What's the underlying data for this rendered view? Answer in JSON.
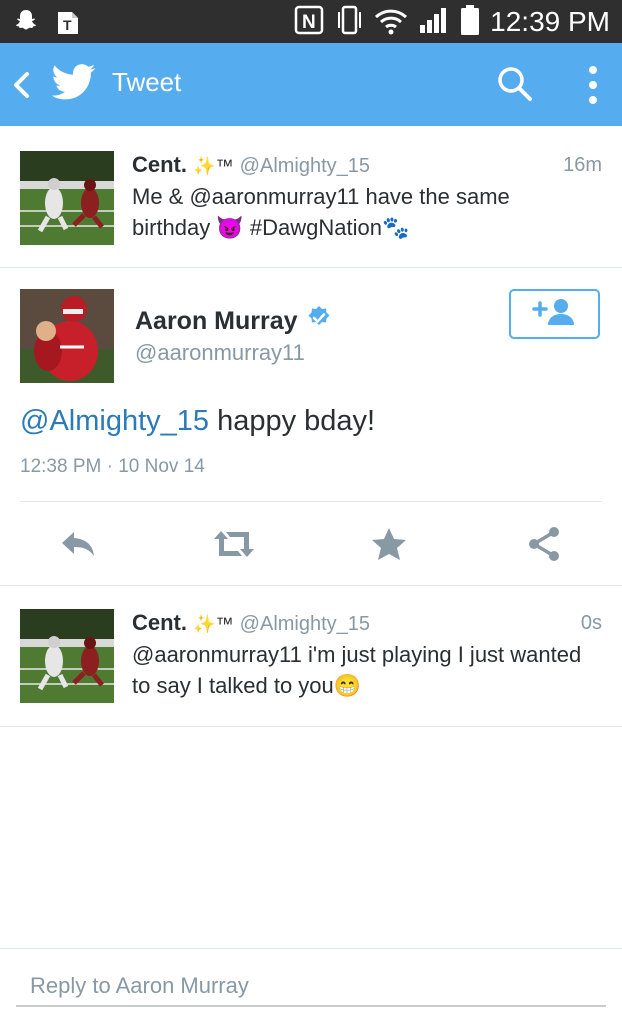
{
  "status_bar": {
    "time": "12:39 PM"
  },
  "action_bar": {
    "title": "Tweet"
  },
  "tweets_above": [
    {
      "name": "Cent.",
      "name_suffix": "✨™",
      "handle": "@Almighty_15",
      "time": "16m",
      "text": "Me & @aaronmurray11 have the same birthday 😈 #DawgNation🐾"
    }
  ],
  "main_tweet": {
    "name": "Aaron Murray",
    "handle": "@aaronmurray11",
    "mention": "@Almighty_15",
    "text": " happy bday!",
    "timestamp": "12:38 PM · 10 Nov 14"
  },
  "tweets_below": [
    {
      "name": "Cent.",
      "name_suffix": "✨™",
      "handle": "@Almighty_15",
      "time": "0s",
      "text": "@aaronmurray11 i'm just playing I just wanted to say I talked to you😁"
    }
  ],
  "reply": {
    "placeholder": "Reply to Aaron Murray"
  },
  "colors": {
    "twitter_blue": "#55acee",
    "link": "#2b7bb9",
    "muted": "#8899a6",
    "text": "#292f33"
  }
}
